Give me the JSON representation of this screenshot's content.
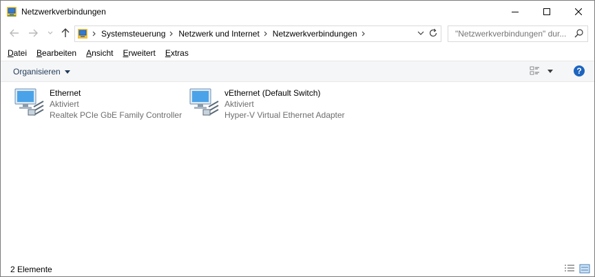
{
  "window": {
    "title": "Netzwerkverbindungen",
    "controls": [
      "minimize-icon",
      "maximize-icon",
      "close-icon"
    ]
  },
  "address": {
    "crumbs": [
      "Systemsteuerung",
      "Netzwerk und Internet",
      "Netzwerkverbindungen"
    ]
  },
  "search": {
    "placeholder": "\"Netzwerkverbindungen\" dur..."
  },
  "menu": {
    "items": [
      {
        "u": "D",
        "rest": "atei"
      },
      {
        "u": "B",
        "rest": "earbeiten"
      },
      {
        "u": "A",
        "rest": "nsicht"
      },
      {
        "u": "E",
        "rest": "rweitert"
      },
      {
        "u": "E",
        "rest": "xtras"
      }
    ]
  },
  "toolbar": {
    "organize": "Organisieren",
    "help": "?"
  },
  "connections": [
    {
      "name": "Ethernet",
      "status": "Aktiviert",
      "adapter": "Realtek PCIe GbE Family Controller"
    },
    {
      "name": "vEthernet (Default Switch)",
      "status": "Aktiviert",
      "adapter": "Hyper-V Virtual Ethernet Adapter"
    }
  ],
  "status": {
    "count": "2 Elemente"
  },
  "colors": {
    "accent": "#1c64c0",
    "link": "#1e395b",
    "muted": "#6d6d6d"
  }
}
